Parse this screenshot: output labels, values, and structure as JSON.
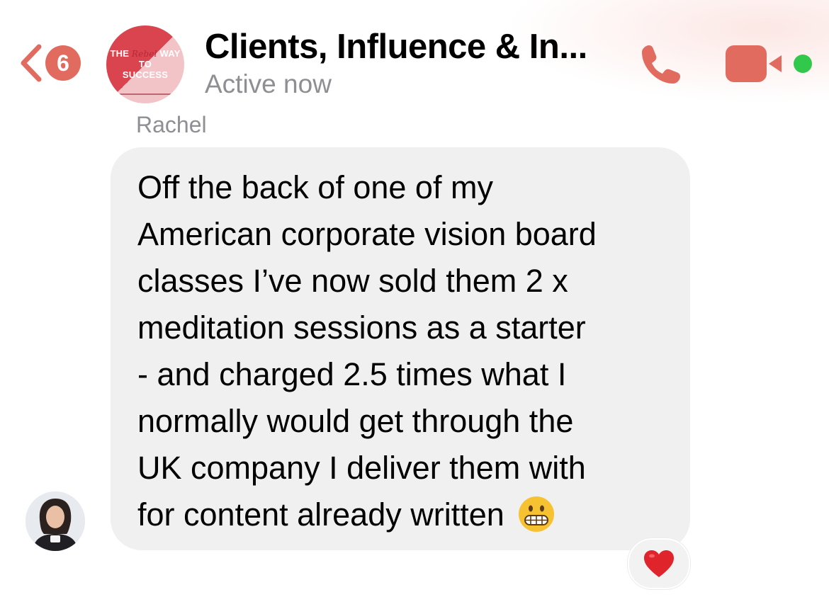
{
  "header": {
    "back_badge_count": "6",
    "title": "Clients, Influence & In...",
    "status": "Active now",
    "group_avatar_logo": {
      "line1_a": "THE",
      "line1_b": "Rebel",
      "line1_c": "WAY",
      "line2": "TO",
      "line3": "SUCCESS"
    },
    "icons": {
      "back": "chevron-left-icon",
      "call": "phone-icon",
      "video": "video-camera-icon",
      "presence": "online-dot"
    }
  },
  "message": {
    "sender": "Rachel",
    "lines": [
      "Off the back of one of my",
      "American corporate vision board",
      "classes I’ve now sold them 2 x",
      "meditation sessions as a starter",
      "- and charged 2.5 times what I",
      "normally would get through the",
      "UK company I deliver them with",
      "for content already written"
    ],
    "trailing_emoji": "grimacing-face-emoji",
    "reaction": "red-heart-icon"
  },
  "colors": {
    "accent": "#e26b5f",
    "online": "#31c84c",
    "bubble": "#f0f0f0",
    "secondary_text": "#8e8e93",
    "heart": "#e0242b"
  }
}
